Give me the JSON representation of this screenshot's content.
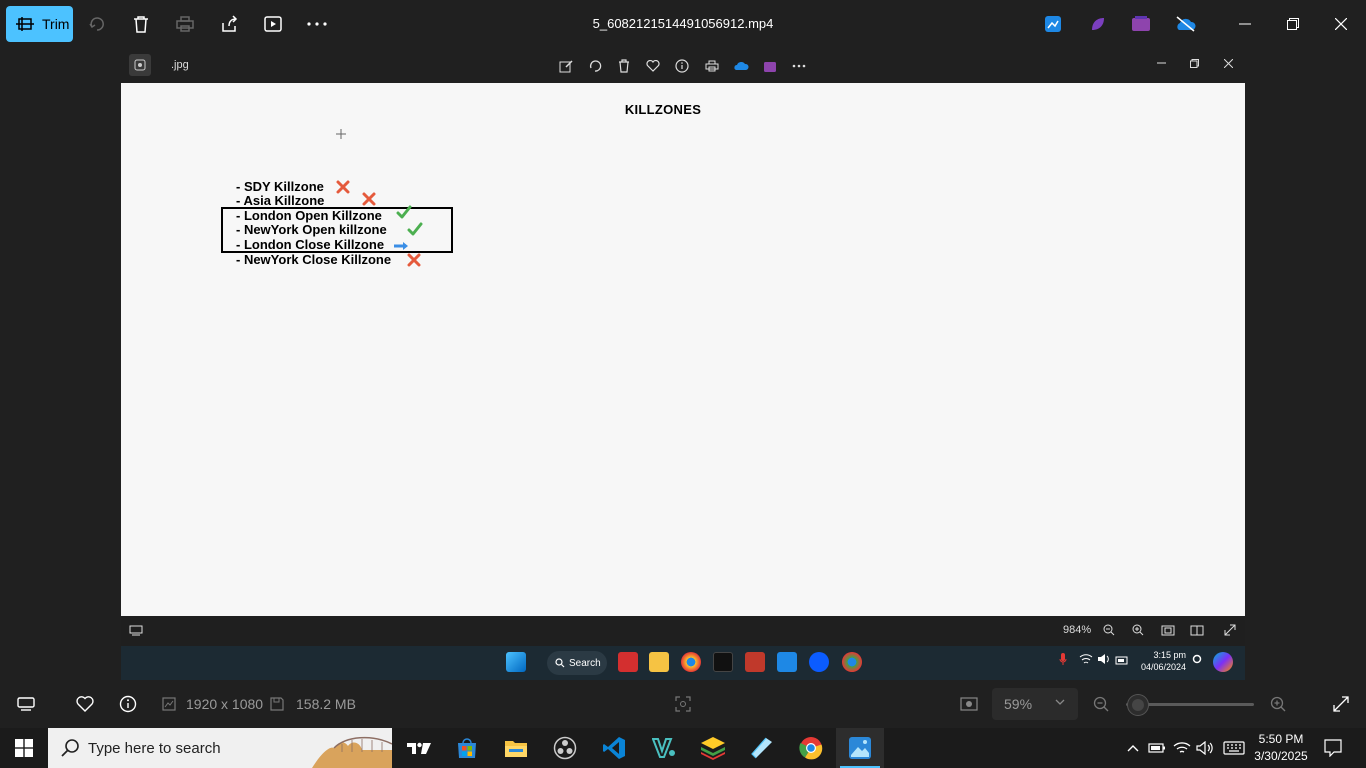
{
  "outer_toolbar": {
    "trim_label": "Trim",
    "file_title": "5_6082121514491056912.mp4"
  },
  "inner_viewer": {
    "tab_label": ".jpg",
    "document": {
      "title": "KILLZONES",
      "items": [
        {
          "text": "- SDY Killzone",
          "status": "cross"
        },
        {
          "text": "- Asia Killzone",
          "status": "cross"
        },
        {
          "text": "- London Open Killzone",
          "status": "check"
        },
        {
          "text": "- NewYork Open killzone",
          "status": "check"
        },
        {
          "text": "- London Close Killzone",
          "status": "arrow"
        },
        {
          "text": "- NewYork Close Killzone",
          "status": "cross"
        }
      ],
      "colors": {
        "cross": "#e55a3c",
        "check": "#4caf50",
        "arrow": "#3a8ee6"
      }
    },
    "zoom": "984%",
    "taskbar": {
      "search_label": "Search",
      "clock_time": "3:15 pm",
      "clock_date": "04/06/2024"
    }
  },
  "status_bar": {
    "dimensions": "1920 x 1080",
    "file_size": "158.2 MB",
    "zoom_value": "59%",
    "zoom_level": 0.05
  },
  "taskbar": {
    "search_placeholder": "Type here to search",
    "clock_time": "5:50 PM",
    "clock_date": "3/30/2025"
  },
  "colors": {
    "accent": "#4cc2ff",
    "canvas_bg": "#f7f7f7",
    "app_bg": "#202020"
  }
}
